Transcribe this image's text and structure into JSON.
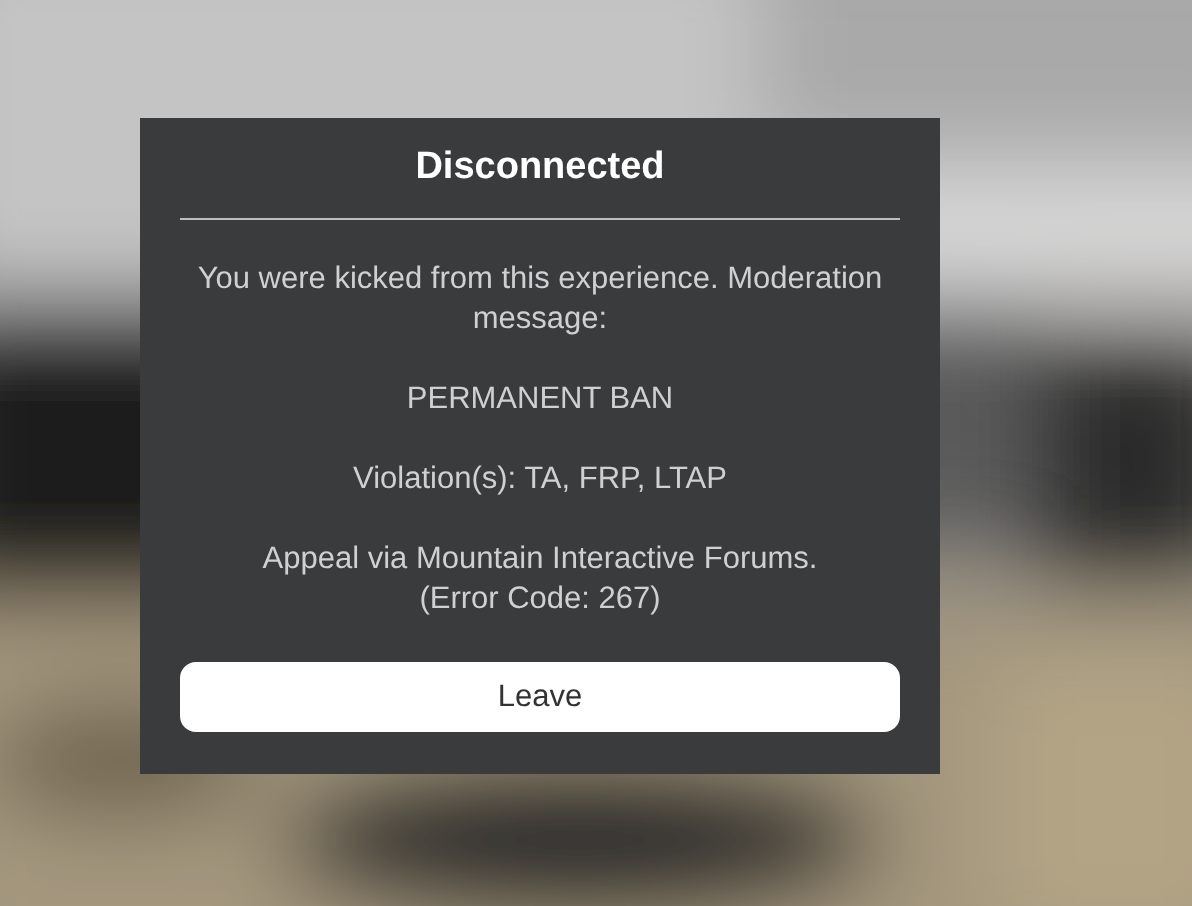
{
  "dialog": {
    "title": "Disconnected",
    "paragraphs": [
      {
        "lines": [
          "You were kicked from this experience. Moderation message:"
        ]
      },
      {
        "lines": [
          "PERMANENT BAN"
        ]
      },
      {
        "lines": [
          "Violation(s): TA, FRP, LTAP"
        ]
      },
      {
        "lines": [
          "Appeal via Mountain Interactive Forums.",
          "(Error Code: 267)"
        ]
      }
    ],
    "button": "Leave"
  }
}
